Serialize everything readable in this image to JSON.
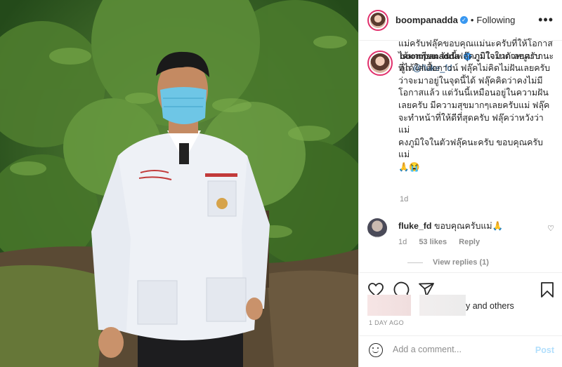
{
  "header": {
    "username": "boompanadda",
    "separator": "•",
    "follow_state": "Following",
    "more": "•••"
  },
  "caption": {
    "username": "boompanadda",
    "first_line": "ภูมิใจในตัวหนูมากนะลูก",
    "mention": "@fluke_fd",
    "text": "แม่ครับฟลุ๊คขอบคุณแม่นะครับที่ให้โอกาส\nได้มาเรียน วันนี้ฟลุ๊คภูมิใจมากเลยครับ\nที่ได้ใส่เสื้อกาวน์ ฟลุ๊คไม่คิดไม่ฝันเลยครับ\nว่าจะมาอยู่ในจุดนี้ได้ ฟลุ๊คคิดว่าคงไม่มี\nโอกาสแล้ว แต่วันนี้เหมือนอยู่ในความฝัน\nเลยครับ มีความสุขมากๆเลยครับแม่ ฟลุ๊ค\nจะทำหน้าที่ให้ดีที่สุดครับ ฟลุ๊คว่าหวังว่าแม่\nคงภูมิใจในตัวฟลุ๊คนะครับ ขอบคุณครับแม่\n🙏😭",
    "time": "1d"
  },
  "comment": {
    "username": "fluke_fd",
    "text": "ขอบคุณครับแม่🙏",
    "time": "1d",
    "likes": "53 likes",
    "reply": "Reply",
    "view_replies": "View replies (1)"
  },
  "likes": {
    "suffix": "y and others"
  },
  "timestamp": "1 DAY AGO",
  "add_comment": {
    "placeholder": "Add a comment...",
    "post": "Post"
  },
  "icons": [
    "heart-icon",
    "comment-icon",
    "share-icon",
    "bookmark-icon",
    "smile-icon",
    "verified-icon",
    "more-icon"
  ]
}
